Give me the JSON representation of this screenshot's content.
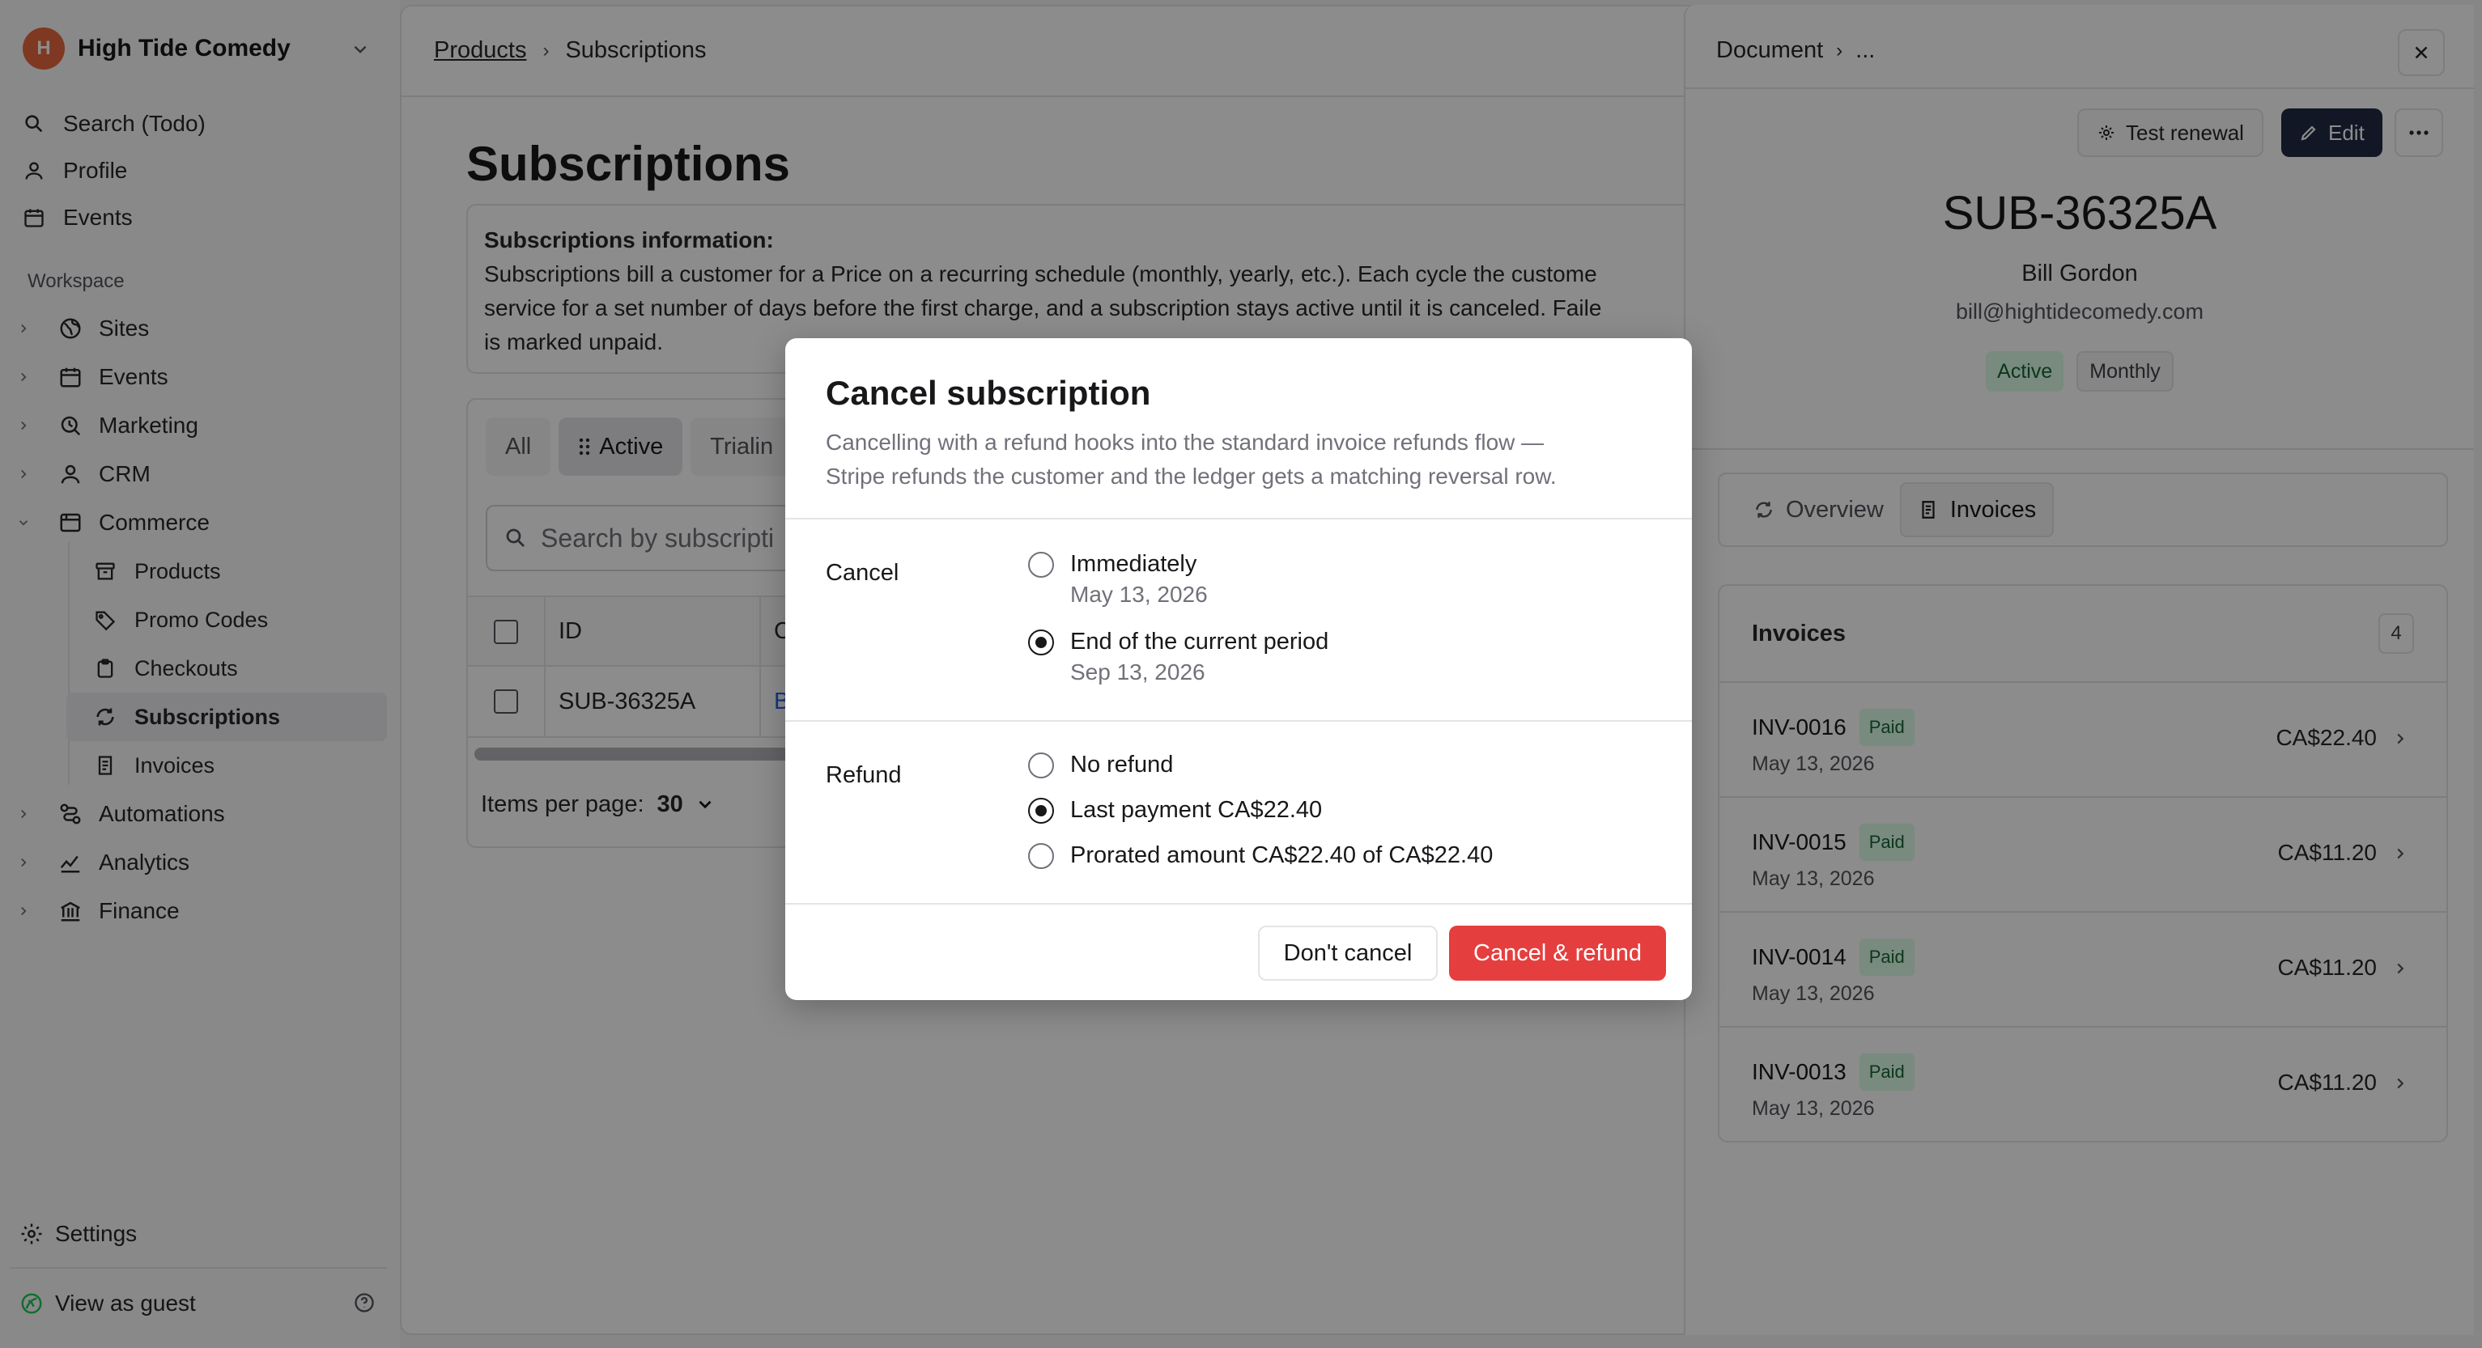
{
  "sidebar": {
    "org_name": "High Tide Comedy",
    "org_logo_text": "H",
    "top_items": [
      {
        "label": "Search (Todo)",
        "icon": "search-icon"
      },
      {
        "label": "Profile",
        "icon": "user-icon"
      },
      {
        "label": "Events",
        "icon": "calendar-icon"
      }
    ],
    "workspace_label": "Workspace",
    "tree": [
      {
        "label": "Sites",
        "icon": "globe-icon"
      },
      {
        "label": "Events",
        "icon": "calendar-icon"
      },
      {
        "label": "Marketing",
        "icon": "marketing-icon"
      },
      {
        "label": "CRM",
        "icon": "user-icon"
      },
      {
        "label": "Commerce",
        "icon": "store-icon"
      }
    ],
    "commerce_children": [
      {
        "label": "Products",
        "icon": "archive-icon"
      },
      {
        "label": "Promo Codes",
        "icon": "tag-icon"
      },
      {
        "label": "Checkouts",
        "icon": "clipboard-icon"
      },
      {
        "label": "Subscriptions",
        "icon": "refresh-icon",
        "active": true
      },
      {
        "label": "Invoices",
        "icon": "receipt-icon"
      }
    ],
    "tree_after": [
      {
        "label": "Automations",
        "icon": "workflow-icon"
      },
      {
        "label": "Analytics",
        "icon": "analytics-icon"
      },
      {
        "label": "Finance",
        "icon": "bank-icon"
      }
    ],
    "settings_label": "Settings",
    "guest_label": "View as guest"
  },
  "main": {
    "breadcrumb": {
      "parent": "Products",
      "current": "Subscriptions"
    },
    "title": "Subscriptions",
    "info": {
      "heading": "Subscriptions information:",
      "line1": "Subscriptions bill a customer for a Price on a recurring schedule (monthly, yearly, etc.). Each cycle the custome",
      "line2": "service for a set number of days before the first charge, and a subscription stays active until it is canceled. Faile",
      "line3": "is marked unpaid."
    },
    "tabs": [
      "All",
      "Active",
      "Trialin"
    ],
    "search_placeholder": "Search by subscripti",
    "columns": [
      "ID",
      "C"
    ],
    "rows": [
      {
        "id": "SUB-36325A",
        "customer": "Bi"
      }
    ],
    "pager": {
      "label": "Items per page:",
      "value": "30"
    }
  },
  "panel": {
    "breadcrumb": {
      "root": "Document",
      "more": "..."
    },
    "test_renewal_label": "Test renewal",
    "edit_label": "Edit",
    "sub_id": "SUB-36325A",
    "customer_name": "Bill Gordon",
    "customer_email": "bill@hightidecomedy.com",
    "badges": {
      "status": "Active",
      "interval": "Monthly"
    },
    "tabs": {
      "overview": "Overview",
      "invoices": "Invoices"
    },
    "invoices_title": "Invoices",
    "invoices_count": "4",
    "invoices": [
      {
        "number": "INV-0016",
        "status": "Paid",
        "date": "May 13, 2026",
        "amount": "CA$22.40"
      },
      {
        "number": "INV-0015",
        "status": "Paid",
        "date": "May 13, 2026",
        "amount": "CA$11.20"
      },
      {
        "number": "INV-0014",
        "status": "Paid",
        "date": "May 13, 2026",
        "amount": "CA$11.20"
      },
      {
        "number": "INV-0013",
        "status": "Paid",
        "date": "May 13, 2026",
        "amount": "CA$11.20"
      }
    ]
  },
  "modal": {
    "title": "Cancel subscription",
    "desc_line1": "Cancelling with a refund hooks into the standard invoice refunds flow —",
    "desc_line2": "Stripe refunds the customer and the ledger gets a matching reversal row.",
    "cancel_label": "Cancel",
    "cancel_options": [
      {
        "label": "Immediately",
        "sub": "May 13, 2026",
        "selected": false
      },
      {
        "label": "End of the current period",
        "sub": "Sep 13, 2026",
        "selected": true
      }
    ],
    "refund_label": "Refund",
    "refund_options": [
      {
        "label": "No refund",
        "selected": false
      },
      {
        "label": "Last payment CA$22.40",
        "selected": true
      },
      {
        "label": "Prorated amount CA$22.40 of CA$22.40",
        "selected": false
      }
    ],
    "dont_cancel_label": "Don't cancel",
    "confirm_label": "Cancel & refund"
  },
  "colors": {
    "brand": "#e8663d",
    "danger": "#e53e3e",
    "success_bg": "#dcfce7",
    "primary_dark": "#1f2a44"
  }
}
